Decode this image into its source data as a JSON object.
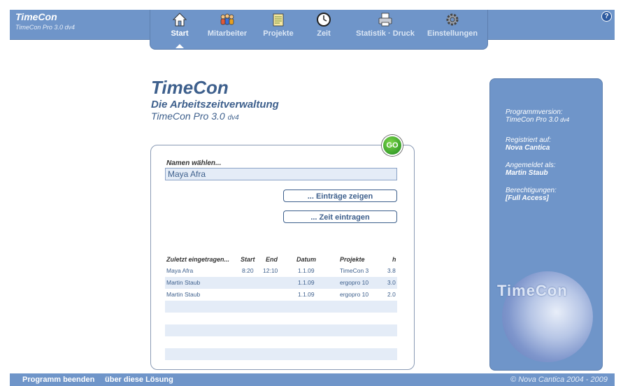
{
  "header": {
    "app_title": "TimeCon",
    "app_subtitle": "TimeCon Pro 3.0 dv4"
  },
  "nav": [
    {
      "label": "Start",
      "icon": "home-icon",
      "active": true
    },
    {
      "label": "Mitarbeiter",
      "icon": "people-icon"
    },
    {
      "label": "Projekte",
      "icon": "notepad-icon"
    },
    {
      "label": "Zeit",
      "icon": "clock-icon"
    },
    {
      "label": "Statistik · Druck",
      "icon": "printer-icon"
    },
    {
      "label": "Einstellungen",
      "icon": "gear-icon"
    }
  ],
  "brand": {
    "title": "TimeCon",
    "subtitle": "Die Arbeitszeitverwaltung",
    "version": "TimeCon Pro 3.0",
    "version_suffix": "dv4"
  },
  "form": {
    "go_label": "GO",
    "name_label": "Namen wählen...",
    "name_value": "Maya Afra",
    "show_entries_button": "... Einträge zeigen",
    "enter_time_button": "... Zeit eintragen"
  },
  "recent": {
    "headers": [
      "Zuletzt eingetragen...",
      "Start",
      "End",
      "Datum",
      "Projekte",
      "h"
    ],
    "rows": [
      [
        "Maya Afra",
        "8:20",
        "12:10",
        "1.1.09",
        "TimeCon 3",
        "3.8"
      ],
      [
        "Martin Staub",
        "",
        "",
        "1.1.09",
        "ergopro 10",
        "3.0"
      ],
      [
        "Martin Staub",
        "",
        "",
        "1.1.09",
        "ergopro 10",
        "2.0"
      ]
    ]
  },
  "side": {
    "program_version_label": "Programmversion:",
    "program_version_value": "TimeCon Pro 3.0",
    "program_version_suffix": "dv4",
    "registered_label": "Registriert auf:",
    "registered_value": "Nova Cantica",
    "logged_in_label": "Angemeldet als:",
    "logged_in_value": "Martin Staub",
    "permissions_label": "Berechtigungen:",
    "permissions_value": "[Full Access]",
    "logo_text": "TimeCon"
  },
  "footer": {
    "quit": "Programm beenden",
    "about": "über diese Lösung",
    "copyright": "© Nova Cantica 2004 - 2009"
  },
  "colors": {
    "accent": "#6f95c9",
    "text_blue": "#3d5f8c",
    "row_alt": "#e4ecf7"
  }
}
